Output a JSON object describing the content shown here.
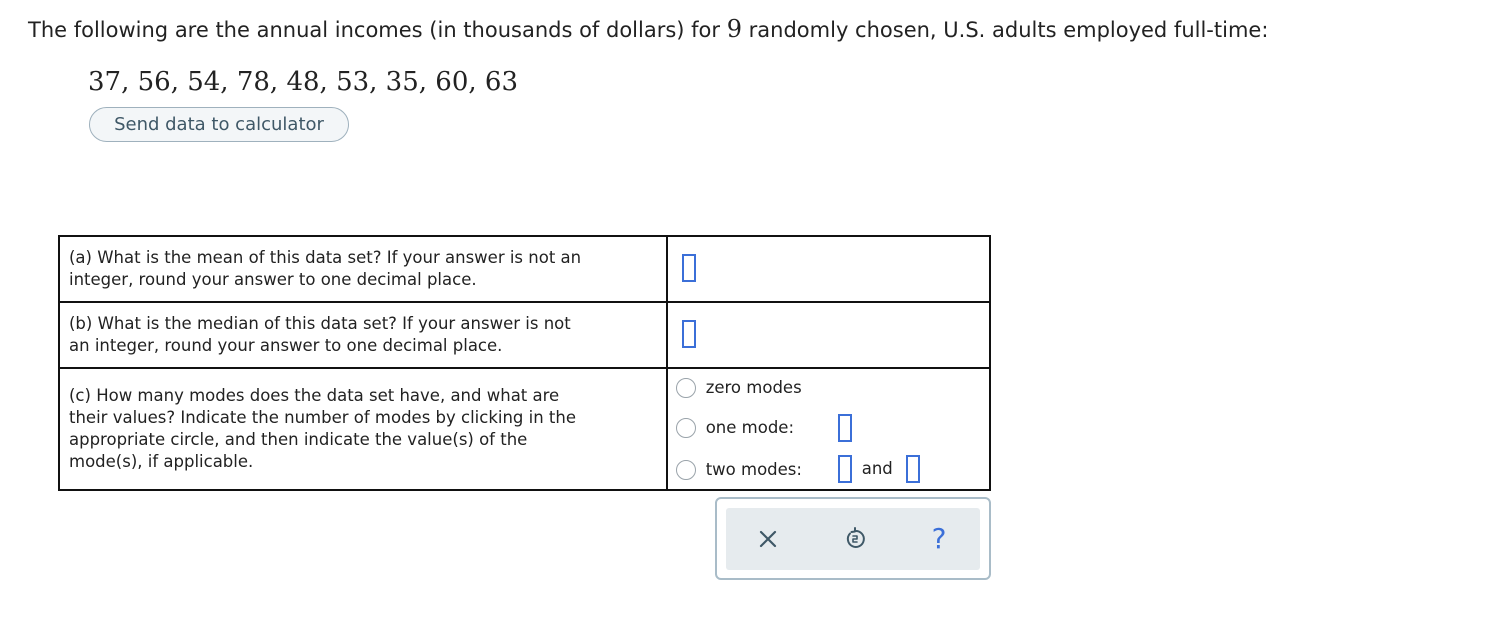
{
  "intro": {
    "before": "The following are the annual incomes (in thousands of dollars) for ",
    "n": "9",
    "after": " randomly chosen, U.S. adults employed full-time:"
  },
  "data_values": "37, 56, 54, 78, 48, 53, 35, 60, 63",
  "send_button_label": "Send data to calculator",
  "questions": {
    "a": {
      "line1": "(a) What is the mean of this data set? If your answer is not an",
      "line2": "integer, round your answer to one decimal place.",
      "answer_value": ""
    },
    "b": {
      "line1": "(b) What is the median of this data set? If your answer is not",
      "line2": "an integer, round your answer to one decimal place.",
      "answer_value": ""
    },
    "c": {
      "line1": "(c) How many modes does the data set have, and what are",
      "line2": "their values? Indicate the number of modes by clicking in the",
      "line3": "appropriate circle, and then indicate the value(s) of the",
      "line4": "mode(s), if applicable.",
      "options": {
        "zero": "zero modes",
        "one": "one mode:",
        "two": "two modes:",
        "and": "and"
      }
    }
  },
  "toolbar": {
    "clear_icon": "x-icon",
    "undo_icon": "undo-icon",
    "help_icon": "question-icon",
    "help_glyph": "?"
  },
  "colors": {
    "answer_box_border": "#3b6fd8",
    "button_text": "#3f5867",
    "toolbar_icon": "#3f5867",
    "help_icon": "#3b6fd8"
  }
}
